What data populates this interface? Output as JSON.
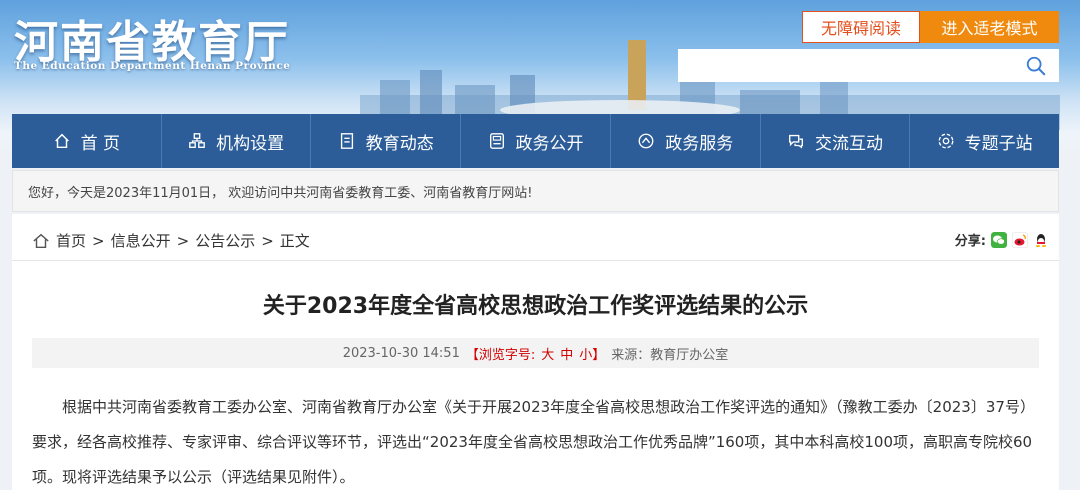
{
  "header": {
    "logo_cn": "河南省教育厅",
    "logo_en": "The Education Department Henan Province",
    "access_button": "无障碍阅读",
    "elder_button": "进入适老模式",
    "search_placeholder": ""
  },
  "nav": {
    "items": [
      {
        "label": "首 页",
        "icon": "home-icon"
      },
      {
        "label": "机构设置",
        "icon": "org-icon"
      },
      {
        "label": "教育动态",
        "icon": "news-icon"
      },
      {
        "label": "政务公开",
        "icon": "doc-icon"
      },
      {
        "label": "政务服务",
        "icon": "service-icon"
      },
      {
        "label": "交流互动",
        "icon": "interact-icon"
      },
      {
        "label": "专题子站",
        "icon": "topic-icon"
      }
    ]
  },
  "welcome": "您好，今天是2023年11月01日， 欢迎访问中共河南省委教育工委、河南省教育厅网站!",
  "breadcrumb": {
    "home": "首页",
    "sep1": ">",
    "level1": "信息公开",
    "sep2": ">",
    "level2": "公告公示",
    "sep3": ">",
    "current": "正文"
  },
  "share_label": "分享:",
  "article": {
    "title": "关于2023年度全省高校思想政治工作奖评选结果的公示",
    "date": "2023-10-30 14:51",
    "font_size_prefix": "【浏览字号:",
    "font_large": "大",
    "font_medium": "中",
    "font_small": "小】",
    "source": "来源：教育厅办公室",
    "paragraph": "根据中共河南省委教育工委办公室、河南省教育厅办公室《关于开展2023年度全省高校思想政治工作奖评选的通知》（豫教工委办〔2023〕37号）要求，经各高校推荐、专家评审、综合评议等环节，评选出“2023年度全省高校思想政治工作优秀品牌”160项，其中本科高校100项，高职高专院校60项。现将评选结果予以公示（评选结果见附件）。"
  },
  "colors": {
    "nav_bg": "#2c5d99",
    "access_border": "#e4501d",
    "elder_bg": "#ef8a0e",
    "accent_red": "#d20000"
  }
}
